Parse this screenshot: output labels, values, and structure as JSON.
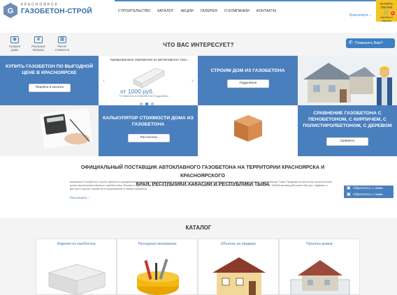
{
  "header": {
    "logo_top": "КРАСНОЯРСК",
    "logo_name": "ГАЗОБЕТОН-СТРОЙ",
    "nav": [
      "СТРОИТЕЛЬСТВО",
      "КАТАЛОГ",
      "АКЦИИ",
      "ГАЛЕРЕЯ",
      "О КОМПАНИИ",
      "КОНТАКТЫ"
    ],
    "city": "Красноярск ⌄",
    "cart": {
      "line1": "КУПИТЬ",
      "line2": "ONLINE",
      "count": "0",
      "link": "перейти в корзину"
    }
  },
  "interest": {
    "title": "ЧТО ВАС ИНТЕРЕСУЕТ?",
    "quick": [
      {
        "icon": "camera-icon",
        "label_1": "Галерея",
        "label_2": "дома"
      },
      {
        "icon": "trophy-icon",
        "label_1": "Реальные",
        "label_2": "вопросы"
      },
      {
        "icon": "calculator-icon",
        "label_1": "Расчёт",
        "label_2": "стоимости"
      }
    ],
    "callback_label": "Позвонить Вам?"
  },
  "tiles": {
    "buy": {
      "title_1": "КУПИТЬ ГАЗОБЕТОН ПО ВЫГОДНОЙ",
      "title_2": "ЦЕНЕ В КРАСНОЯРСКЕ",
      "button": "Перейти в каталог"
    },
    "promo": {
      "title": "Армированные перемычки из автоклавного газо...",
      "price": "от 1000 руб.",
      "gost": "ТУ 5828-001-01438099-2013 Подробнее..."
    },
    "build": {
      "title": "СТРОИМ ДОМ ИЗ ГАЗОБЕТОНА",
      "button": "Подробнее"
    },
    "calc": {
      "title_1": "КАЛЬКУЛЯТОР СТОИМОСТИ ДОМА ИЗ",
      "title_2": "ГАЗОБЕТОНА",
      "button": "Рассчитать"
    },
    "compare": {
      "title_1": "СРАВНЕНИЕ ГАЗОБЕТОНА С",
      "title_2": "ПЕНОБЕТОНОМ, С КИРПИЧЕМ, С",
      "title_3": "ПОЛИСТИРОЛБЕТОНОМ, С ДЕРЕВОМ",
      "button": "Сравнить"
    }
  },
  "about": {
    "title_1": "ОФИЦИАЛЬНЫЙ ПОСТАВЩИК АВТОКЛАВНОГО ГАЗОБЕТОНА НА ТЕРРИТОРИИ КРАСНОЯРСКА И КРАСНОЯРСКОГО",
    "title_2": "КРАЯ, РЕСПУБЛИКИ ХАКАСИИ И РЕСПУБЛИКИ ТЫВА",
    "text": "Компания «Газобетон-Строй» является официальным поставщиком автоклавного газобетона на территории Красноярского края, республики Хакасия и республики Тыва. Продажи на местном строительном рынке высококачественных газобетонных блоков по доступным ценам. Продажа автоклавного бетона осуществляется как в небольших объёмах, так и оптом. Любой желающий может быстро, надёжно и доступно купить газобетон в Красноярске в нашей компании.",
    "read_more": "Рассказать ↓",
    "contact_1": "Обратитесь с нами",
    "contact_2": "Обратитесь с нами"
  },
  "catalog": {
    "title": "КАТАЛОГ",
    "cards": [
      "Изделия из газобетона",
      "Расходные материалы",
      "Объекты на продажу",
      "Проекты домов"
    ]
  },
  "colors": {
    "brand_blue": "#4a7fbd",
    "cart_yellow": "#f3c423",
    "link_blue": "#3e7bbb"
  }
}
